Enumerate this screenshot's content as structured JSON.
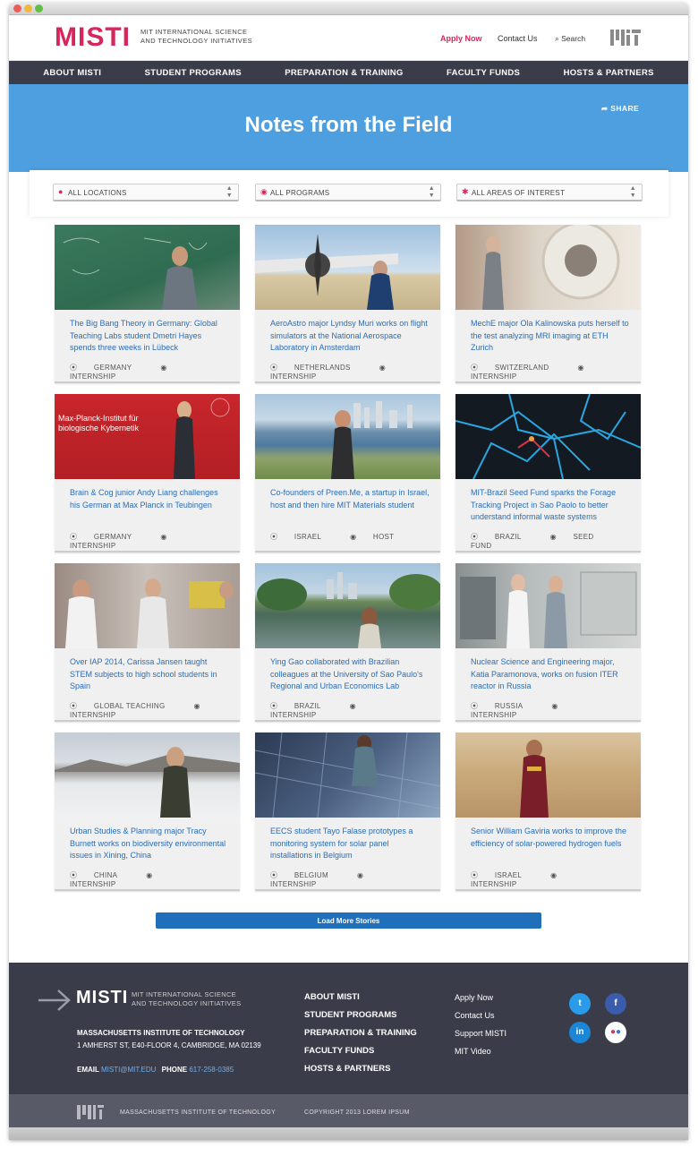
{
  "header": {
    "logo": "MISTI",
    "tagline_1": "MIT INTERNATIONAL SCIENCE",
    "tagline_2": "AND TECHNOLOGY INITIATIVES",
    "apply": "Apply Now",
    "contact": "Contact Us",
    "search": "Search",
    "search_icon": "search-icon"
  },
  "nav": [
    "ABOUT MISTI",
    "STUDENT PROGRAMS",
    "PREPARATION & TRAINING",
    "FACULTY FUNDS",
    "HOSTS & PARTNERS"
  ],
  "hero": {
    "title": "Notes from the Field",
    "share": "SHARE"
  },
  "filters": {
    "locations": "ALL LOCATIONS",
    "programs": "ALL PROGRAMS",
    "areas": "ALL AREAS OF INTEREST"
  },
  "cards": [
    {
      "caption": "The Big Bang Theory in Germany: Global Teaching Labs student Dmetri Hayes spends three weeks in Lübeck",
      "location": "GERMANY",
      "type": "INTERNSHIP"
    },
    {
      "caption": "AeroAstro major Lyndsy Muri works on flight simulators at the National Aerospace Laboratory in Amsterdam",
      "location": "NETHERLANDS",
      "type": "INTERNSHIP"
    },
    {
      "caption": "MechE major Ola Kalinowska puts herself to the test analyzing MRI imaging at ETH Zurich",
      "location": "SWITZERLAND",
      "type": "INTERNSHIP"
    },
    {
      "caption": "Brain & Cog junior Andy Liang challenges his German at Max Planck in Teubingen",
      "location": "GERMANY",
      "type": "INTERNSHIP"
    },
    {
      "caption": "Co-founders of Preen.Me, a startup in Israel, host and then hire MIT Materials student",
      "location": "ISRAEL",
      "type": "HOST"
    },
    {
      "caption": "MIT-Brazil Seed Fund sparks the Forage Tracking Project in Sao Paolo to better understand informal waste systems",
      "location": "BRAZIL",
      "type": "SEED FUND"
    },
    {
      "caption": "Over IAP 2014, Carissa Jansen taught STEM subjects to high school students in Spain",
      "location": "GLOBAL TEACHING",
      "type": "INTERNSHIP"
    },
    {
      "caption": "Ying Gao collaborated with Brazilian colleagues at the University of Sao Paulo's Regional and Urban Economics Lab",
      "location": "BRAZIL",
      "type": "INTERNSHIP"
    },
    {
      "caption": "Nuclear Science and Engineering major, Katia Paramonova, works on fusion ITER reactor in Russia",
      "location": "RUSSIA",
      "type": "INTERNSHIP"
    },
    {
      "caption": "Urban Studies & Planning major Tracy Burnett works on biodiversity environmental issues in Xining, China",
      "location": "CHINA",
      "type": "INTERNSHIP"
    },
    {
      "caption": "EECS student Tayo Falase prototypes a monitoring system for solar panel installations in Belgium",
      "location": "BELGIUM",
      "type": "INTERNSHIP"
    },
    {
      "caption": "Senior William Gaviria works to improve the efficiency of solar-powered hydrogen fuels",
      "location": "ISRAEL",
      "type": "INTERNSHIP"
    }
  ],
  "image_text": {
    "max_planck_1": "Max-Planck-Institut für",
    "max_planck_2": "biologische Kybernetik"
  },
  "load_more": "Load More Stories",
  "footer": {
    "logo": "MISTI",
    "tagline_1": "MIT INTERNATIONAL SCIENCE",
    "tagline_2": "AND TECHNOLOGY INITIATIVES",
    "institute": "MASSACHUSETTS INSTITUTE OF TECHNOLOGY",
    "address": "1 AMHERST ST, E40-FLOOR 4, CAMBRIDGE, MA 02139",
    "email_label": "EMAIL",
    "email": "MISTI@MIT.EDU",
    "phone_label": "PHONE",
    "phone": "617-258-0385",
    "nav": [
      "ABOUT MISTI",
      "STUDENT PROGRAMS",
      "PREPARATION & TRAINING",
      "FACULTY FUNDS",
      "HOSTS & PARTNERS"
    ],
    "links": [
      "Apply Now",
      "Contact Us",
      "Support MISTI",
      "MIT Video"
    ],
    "social": {
      "twitter": "twitter-icon",
      "facebook": "facebook-icon",
      "linkedin": "linkedin-icon",
      "flickr": "flickr-icon"
    },
    "bottom_institute": "MASSACHUSETTS INSTITUTE OF TECHNOLOGY",
    "copyright": "COPYRIGHT 2013 LOREM IPSUM"
  },
  "colors": {
    "brand": "#d6265b",
    "nav": "#3a3c4a",
    "hero": "#4e9fe0",
    "link": "#2a6db6",
    "button": "#1f6fba"
  }
}
